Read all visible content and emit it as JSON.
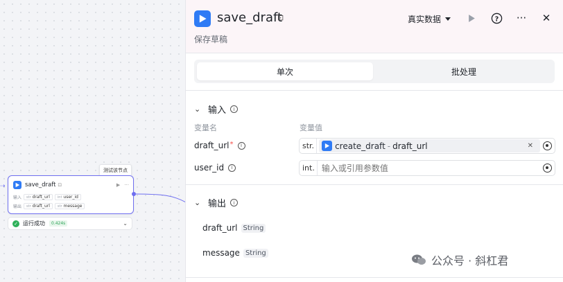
{
  "canvas": {
    "tooltip": "测试该节点",
    "node": {
      "title": "save_draft",
      "input_label": "输入",
      "output_label": "输出",
      "inputs": [
        "draft_url",
        "user_id"
      ],
      "outputs": [
        "draft_url",
        "message"
      ]
    },
    "status": {
      "text": "运行成功",
      "time": "0.424s"
    }
  },
  "panel": {
    "title": "save_draft",
    "subtitle": "保存草稿",
    "data_mode": "真实数据",
    "tabs": [
      {
        "label": "单次",
        "active": true
      },
      {
        "label": "批处理",
        "active": false
      }
    ],
    "input_section": {
      "title": "输入",
      "col_name": "变量名",
      "col_value": "变量值",
      "params": [
        {
          "name": "draft_url",
          "required": true,
          "type": "str.",
          "ref_node": "create_draft",
          "ref_sep": "-",
          "ref_var": "draft_url"
        },
        {
          "name": "user_id",
          "required": false,
          "type": "int.",
          "placeholder": "输入或引用参数值"
        }
      ]
    },
    "output_section": {
      "title": "输出",
      "outputs": [
        {
          "name": "draft_url",
          "type": "String"
        },
        {
          "name": "message",
          "type": "String"
        }
      ]
    }
  },
  "watermark": "公众号 · 斜杠君",
  "colors": {
    "accent": "#6f6ff0",
    "brand_icon": "#2f7bf5",
    "success": "#2fb15a",
    "required": "#f54a45"
  }
}
